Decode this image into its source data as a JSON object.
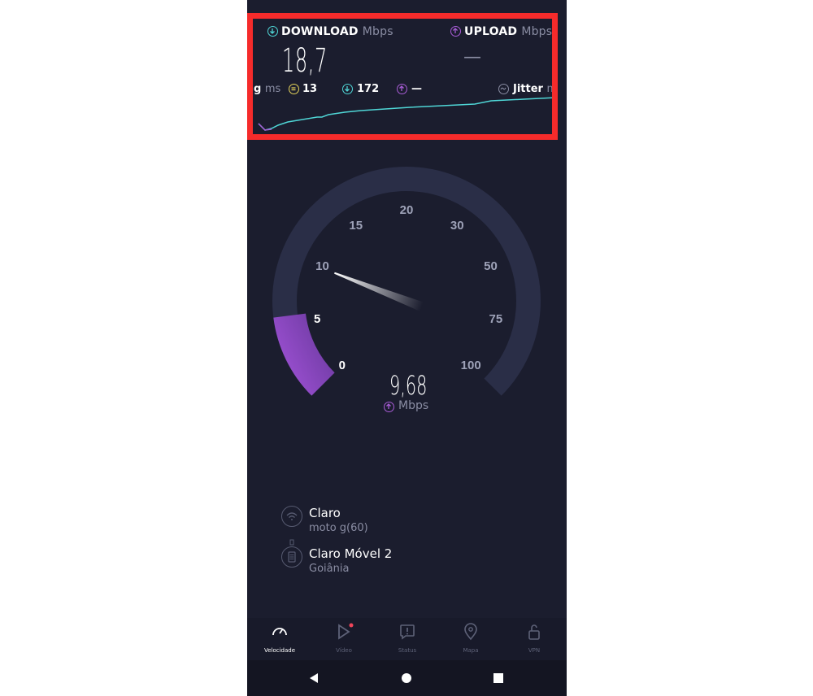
{
  "download": {
    "label": "DOWNLOAD",
    "unit": "Mbps",
    "value": "18,7"
  },
  "upload": {
    "label": "UPLOAD",
    "unit": "Mbps",
    "value": "—"
  },
  "ping": {
    "label_partial": "g",
    "unit": "ms"
  },
  "stats": {
    "idle": "13",
    "down": "172",
    "up": "—"
  },
  "jitter": {
    "label": "Jitter",
    "unit_partial": "m"
  },
  "gauge": {
    "ticks": [
      "0",
      "5",
      "10",
      "15",
      "20",
      "30",
      "50",
      "75",
      "100"
    ],
    "current_value": "9,68",
    "unit": "Mbps",
    "level_tick_fraction": 0.245,
    "mode": "upload"
  },
  "connection": {
    "provider": "Claro",
    "device": "moto g(60)",
    "server": "Claro Móvel 2",
    "city": "Goiânia"
  },
  "nav": {
    "items": [
      {
        "label": "Velocidade",
        "icon": "speedometer-icon",
        "active": true
      },
      {
        "label": "Vídeo",
        "icon": "play-icon",
        "active": false
      },
      {
        "label": "Status",
        "icon": "alert-icon",
        "active": false
      },
      {
        "label": "Mapa",
        "icon": "map-pin-icon",
        "active": false
      },
      {
        "label": "VPN",
        "icon": "lock-icon",
        "active": false
      }
    ]
  },
  "colors": {
    "background": "#1b1d2e",
    "download_accent": "#4fd6d6",
    "upload_accent": "#a85cd6",
    "idle_accent": "#e5d35a",
    "highlight_box": "#f52b2b"
  }
}
